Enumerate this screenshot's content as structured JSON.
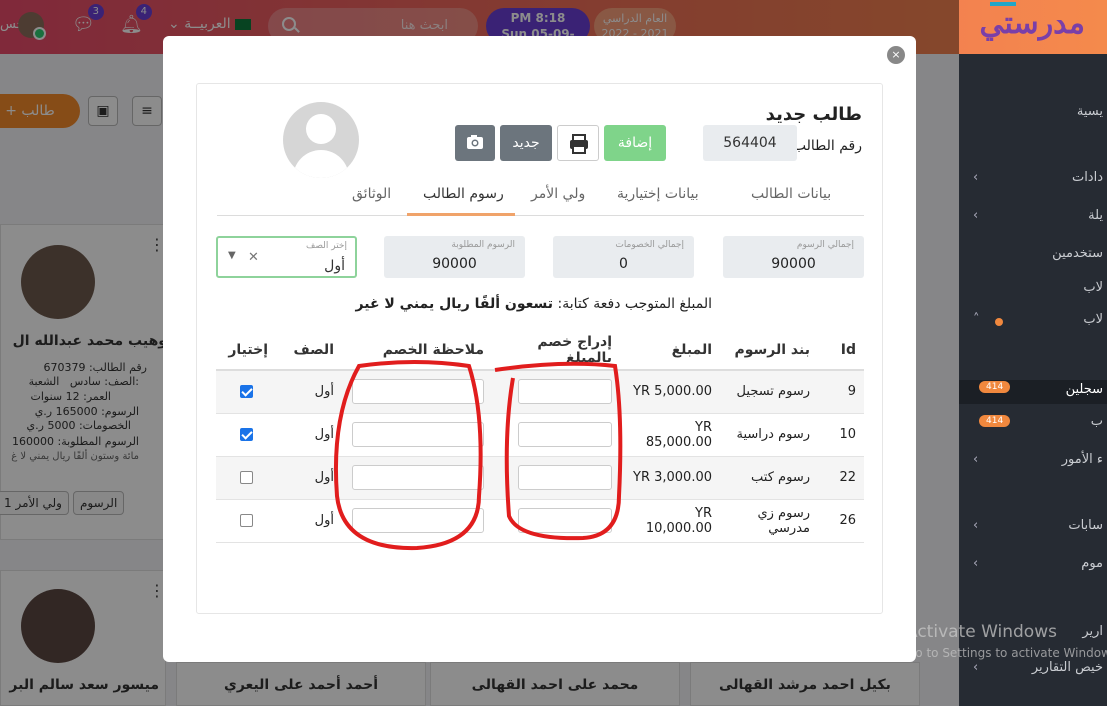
{
  "app": {
    "logo_text": "مدرستي",
    "time": "PM 8:18",
    "date": "Sun 05-09-2021",
    "year_label": "العام الدراسي",
    "year_value": "2022 - 2021",
    "search_placeholder": "ابحث هنا",
    "language": "العربيــة",
    "notifications": "4",
    "messages": "3",
    "user_short": "حس"
  },
  "sidebar": {
    "items": [
      {
        "label": "يسية"
      },
      {
        "label": "دادات"
      },
      {
        "label": "يلة"
      },
      {
        "label": "ستخدمين"
      },
      {
        "label": "لاب"
      },
      {
        "label": "لاب"
      },
      {
        "label": "سجلين",
        "badge": "414"
      },
      {
        "label": "ب",
        "badge": "414"
      },
      {
        "label": "ء الأمور"
      },
      {
        "label": "سابات"
      },
      {
        "label": "موم"
      },
      {
        "label": "ارير"
      },
      {
        "label": "خيص التقارير"
      }
    ]
  },
  "toolbar": {
    "add_student": "طالب"
  },
  "cards": [
    {
      "name": "وهيب محمد عبدالله ال",
      "student_no": "رقم الطالب: 670379",
      "class": "الصف: سادس",
      "division": "الشعبة:",
      "age": "العمر: 12 سنوات",
      "fees": "الرسوم: 165000 ر.ي",
      "discounts": "الخصومات: 5000 ر.ي",
      "required": "الرسوم المطلوبة: 160000",
      "written": "مائة وستون ألفًا ريال يمني لا غ",
      "chip_fees": "الرسوم",
      "chip_guardian": "1 ولي الأمر"
    },
    {
      "name": "ميسور سعد سالم البر"
    }
  ],
  "bottom_names": [
    "بكيل احمد مرشد القهالى",
    "محمد على احمد القهالى",
    "أحمد أحمد على اليعري"
  ],
  "watermark": {
    "line1": "Activate Windows",
    "line2": "Go to Settings to activate Windows"
  },
  "modal": {
    "close": "×",
    "title": "طالب جديد",
    "student_no_label": "رقم الطالب",
    "student_no": "564404",
    "add_button": "إضافة",
    "new_button": "جديد",
    "tabs": [
      "بيانات الطالب",
      "بيانات إختيارية",
      "ولي الأمر",
      "رسوم الطالب",
      "الوثائق"
    ],
    "summary": {
      "total_fees_label": "إجمالي الرسوم",
      "total_fees": "90000",
      "total_discounts_label": "إجمالي الخصومات",
      "total_discounts": "0",
      "required_fees_label": "الرسوم المطلوبة",
      "required_fees": "90000",
      "class_label": "إختر الصف",
      "class_value": "أول"
    },
    "written_label": "المبلغ المتوجب دفعة كتابة:",
    "written_value": "تسعون ألفًا ريال يمني لا غير",
    "table": {
      "headers": [
        "Id",
        "بند الرسوم",
        "المبلغ",
        "إدراج خصم بالمبلغ",
        "ملاحظة الخصم",
        "الصف",
        "إختيار"
      ],
      "rows": [
        {
          "id": "9",
          "item": "رسوم تسجيل",
          "amount": "YR 5,000.00",
          "class": "أول",
          "checked": true
        },
        {
          "id": "10",
          "item": "رسوم دراسية",
          "amount": "YR 85,000.00",
          "class": "أول",
          "checked": true
        },
        {
          "id": "22",
          "item": "رسوم كتب",
          "amount": "YR 3,000.00",
          "class": "أول",
          "checked": false
        },
        {
          "id": "26",
          "item": "رسوم زي مدرسي",
          "amount": "YR 10,000.00",
          "class": "أول",
          "checked": false
        }
      ]
    }
  }
}
